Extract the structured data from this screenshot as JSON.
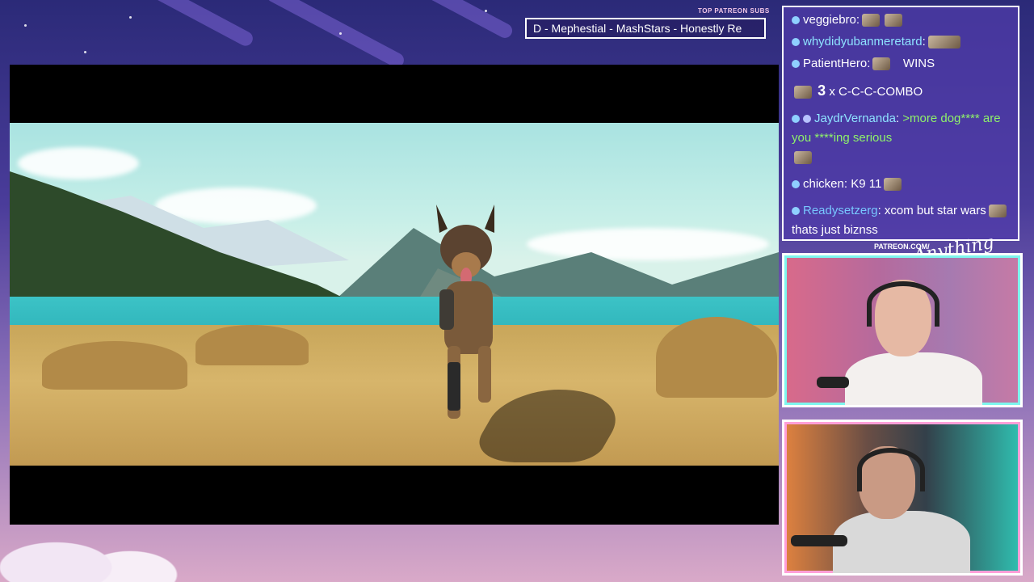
{
  "overlay": {
    "patreon_label": "TOP PATREON SUBS",
    "ticker_text": "D - Mephestial - MashStars - Honestly Re",
    "patreon_url": "PATREON.COM/",
    "logo_text": "Anything Else?"
  },
  "chat": {
    "messages": [
      {
        "user": "veggiebro",
        "text": "",
        "user_color": "#ffffff"
      },
      {
        "user": "whydidyubanmeretard",
        "text": "",
        "user_color": "#8ee3ff"
      },
      {
        "user": "PatientHero",
        "text": "WINS",
        "user_color": "#ffffff"
      },
      {
        "user": "",
        "text": "C-C-C-COMBO",
        "combo_count": "3",
        "combo_x": "x"
      },
      {
        "user": "JaydrVernanda",
        "text": ">more dog**** are you ****ing serious",
        "user_color": "#8ee3ff",
        "text_color": "#8ef26a"
      },
      {
        "user": "chicken",
        "text": "K9 11",
        "user_color": "#ffffff"
      },
      {
        "user": "Readysetzerg",
        "text": "xcom but star wars",
        "text2": "thats just biznss",
        "user_color": "#78c8ff"
      }
    ]
  },
  "video": {
    "subject": "german-shepherd-dog-scene"
  },
  "webcams": {
    "top": "streamer-cam-1",
    "bottom": "streamer-cam-2"
  },
  "colors": {
    "chat_bg": "#5040aa",
    "cam1_border": "#7ef6ee",
    "cam2_border": "#ff9fd8",
    "lake": "#2fb5bb"
  }
}
